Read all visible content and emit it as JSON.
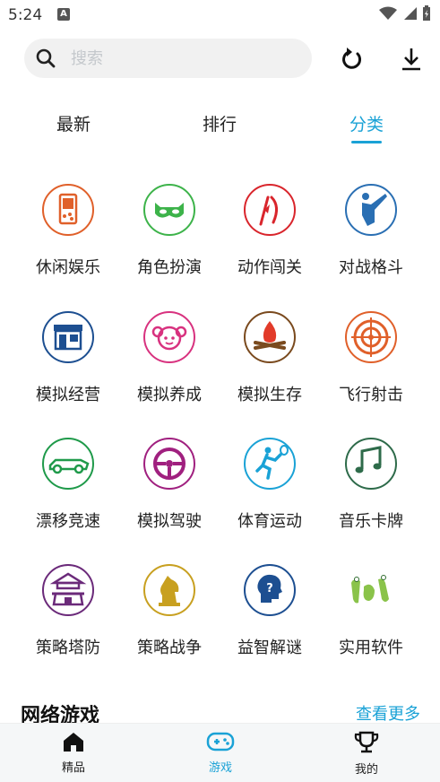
{
  "status": {
    "time": "5:24",
    "notif_icon": "A"
  },
  "search": {
    "placeholder": "搜索"
  },
  "tabs": [
    {
      "label": "最新"
    },
    {
      "label": "排行"
    },
    {
      "label": "分类",
      "active": true
    }
  ],
  "categories": [
    {
      "label": "休闲娱乐",
      "icon": "game-console-icon",
      "color": "#e0602a"
    },
    {
      "label": "角色扮演",
      "icon": "mask-icon",
      "color": "#3db34a"
    },
    {
      "label": "动作闯关",
      "icon": "action-icon",
      "color": "#d9252c"
    },
    {
      "label": "对战格斗",
      "icon": "fighter-icon",
      "color": "#2a6fb3"
    },
    {
      "label": "模拟经营",
      "icon": "shop-icon",
      "color": "#1d4f91"
    },
    {
      "label": "模拟养成",
      "icon": "girl-icon",
      "color": "#d8327f"
    },
    {
      "label": "模拟生存",
      "icon": "campfire-icon",
      "color": "#7a4a1e"
    },
    {
      "label": "飞行射击",
      "icon": "target-icon",
      "color": "#e0602a"
    },
    {
      "label": "漂移竞速",
      "icon": "race-car-icon",
      "color": "#1f9a4a"
    },
    {
      "label": "模拟驾驶",
      "icon": "steering-wheel-icon",
      "color": "#a0207f"
    },
    {
      "label": "体育运动",
      "icon": "tennis-icon",
      "color": "#1aa2d6"
    },
    {
      "label": "音乐卡牌",
      "icon": "music-note-icon",
      "color": "#2e6b4a"
    },
    {
      "label": "策略塔防",
      "icon": "pagoda-icon",
      "color": "#6b2a7a"
    },
    {
      "label": "策略战争",
      "icon": "chess-knight-icon",
      "color": "#c8a020"
    },
    {
      "label": "益智解谜",
      "icon": "puzzle-head-icon",
      "color": "#1d4f91"
    },
    {
      "label": "实用软件",
      "icon": "tools-icon",
      "color": "#7bbf3a"
    }
  ],
  "section": {
    "title": "网络游戏",
    "more": "查看更多"
  },
  "nav": [
    {
      "label": "精品",
      "icon": "home-icon"
    },
    {
      "label": "游戏",
      "icon": "gamepad-icon",
      "active": true
    },
    {
      "label": "我的",
      "icon": "trophy-icon"
    }
  ],
  "colors": {
    "accent": "#1aa2d6"
  }
}
